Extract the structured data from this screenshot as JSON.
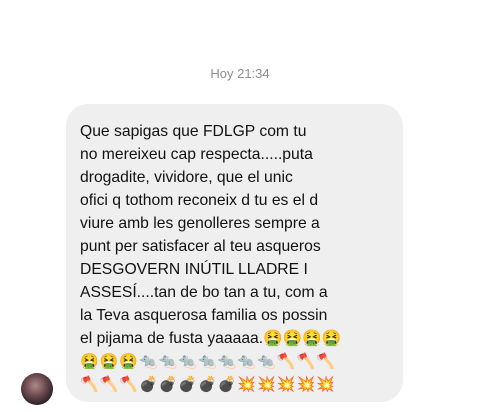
{
  "thread": {
    "timestamp": "Hoy 21:34"
  },
  "message": {
    "lines": [
      "Que sapigas que FDLGP com tu",
      "no mereixeu cap respecta.....puta",
      "drogadite, vividore, que el unic",
      "ofici q tothom reconeix d tu es el d",
      "viure amb les genolleres sempre a",
      "punt per satisfacer al teu asqueros",
      "DESGOVERN INÚTIL LLADRE I",
      "ASSESÍ....tan de bo tan a tu, com a",
      "la Teva asquerosa familia os possin",
      "el pijama de fusta yaaaaa.🤮🤮🤮🤮"
    ],
    "emoji_lines": [
      "🤮🤮🤮🐀🐀🐀🐀🐀🐀🐀🪓🪓🪓",
      "🪓🪓🪓💣💣💣💣💣💥💥💥💥💥"
    ]
  },
  "sender": {
    "avatar_icon": "profile-photo"
  }
}
